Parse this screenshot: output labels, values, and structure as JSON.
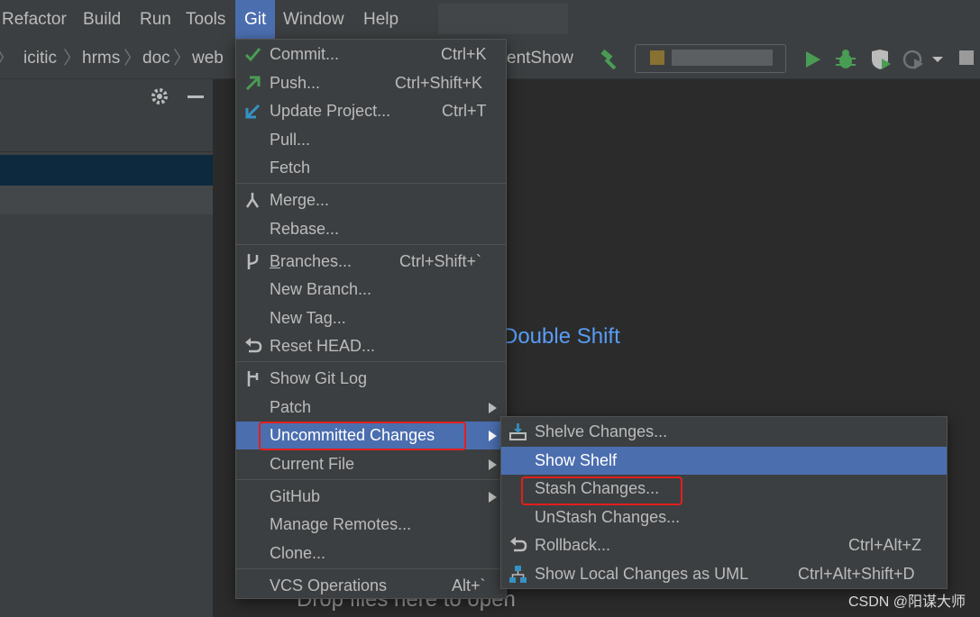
{
  "menubar": {
    "items": [
      "Refactor",
      "Build",
      "Run",
      "Tools",
      "Git",
      "Window",
      "Help"
    ],
    "active": "Git"
  },
  "breadcrumb": [
    "icitic",
    "hrms",
    "doc",
    "web"
  ],
  "run_config_fragment": "entShow",
  "editor": {
    "search_hint": "Double Shift",
    "drop_hint": "Drop files here to open"
  },
  "git_menu": {
    "items": [
      {
        "label": "Commit...",
        "shortcut": "Ctrl+K",
        "icon": "check-icon"
      },
      {
        "label": "Push...",
        "shortcut": "Ctrl+Shift+K",
        "icon": "push-arrow-icon"
      },
      {
        "label": "Update Project...",
        "shortcut": "Ctrl+T",
        "icon": "update-arrow-icon"
      },
      {
        "label": "Pull...",
        "shortcut": ""
      },
      {
        "label": "Fetch",
        "shortcut": ""
      },
      {
        "label": "Merge...",
        "shortcut": "",
        "icon": "merge-icon"
      },
      {
        "label": "Rebase...",
        "shortcut": ""
      },
      {
        "label": "Branches...",
        "shortcut": "Ctrl+Shift+`",
        "icon": "branch-icon"
      },
      {
        "label": "New Branch...",
        "shortcut": ""
      },
      {
        "label": "New Tag...",
        "shortcut": ""
      },
      {
        "label": "Reset HEAD...",
        "shortcut": "",
        "icon": "undo-icon"
      },
      {
        "label": "Show Git Log",
        "shortcut": "",
        "icon": "git-log-icon"
      },
      {
        "label": "Patch",
        "shortcut": "",
        "submenu": true
      },
      {
        "label": "Uncommitted Changes",
        "shortcut": "",
        "submenu": true,
        "highlighted": true
      },
      {
        "label": "Current File",
        "shortcut": "",
        "submenu": true
      },
      {
        "label": "GitHub",
        "shortcut": "",
        "submenu": true
      },
      {
        "label": "Manage Remotes...",
        "shortcut": ""
      },
      {
        "label": "Clone...",
        "shortcut": ""
      },
      {
        "label": "VCS Operations",
        "shortcut": "Alt+`"
      }
    ]
  },
  "uncommitted_submenu": {
    "items": [
      {
        "label": "Shelve Changes...",
        "shortcut": "",
        "icon": "shelve-icon"
      },
      {
        "label": "Show Shelf",
        "shortcut": "",
        "highlighted": true
      },
      {
        "label": "Stash Changes...",
        "shortcut": ""
      },
      {
        "label": "UnStash Changes...",
        "shortcut": ""
      },
      {
        "label": "Rollback...",
        "shortcut": "Ctrl+Alt+Z",
        "icon": "undo-icon"
      },
      {
        "label": "Show Local Changes as UML",
        "shortcut": "Ctrl+Alt+Shift+D",
        "icon": "uml-icon"
      }
    ]
  },
  "watermark": "CSDN @阳谋大师",
  "colors": {
    "menu_bg": "#3c3f41",
    "highlight": "#4b6eaf",
    "annotation_red": "#e0201d",
    "link_blue": "#589df6",
    "editor_bg": "#2b2b2b"
  }
}
